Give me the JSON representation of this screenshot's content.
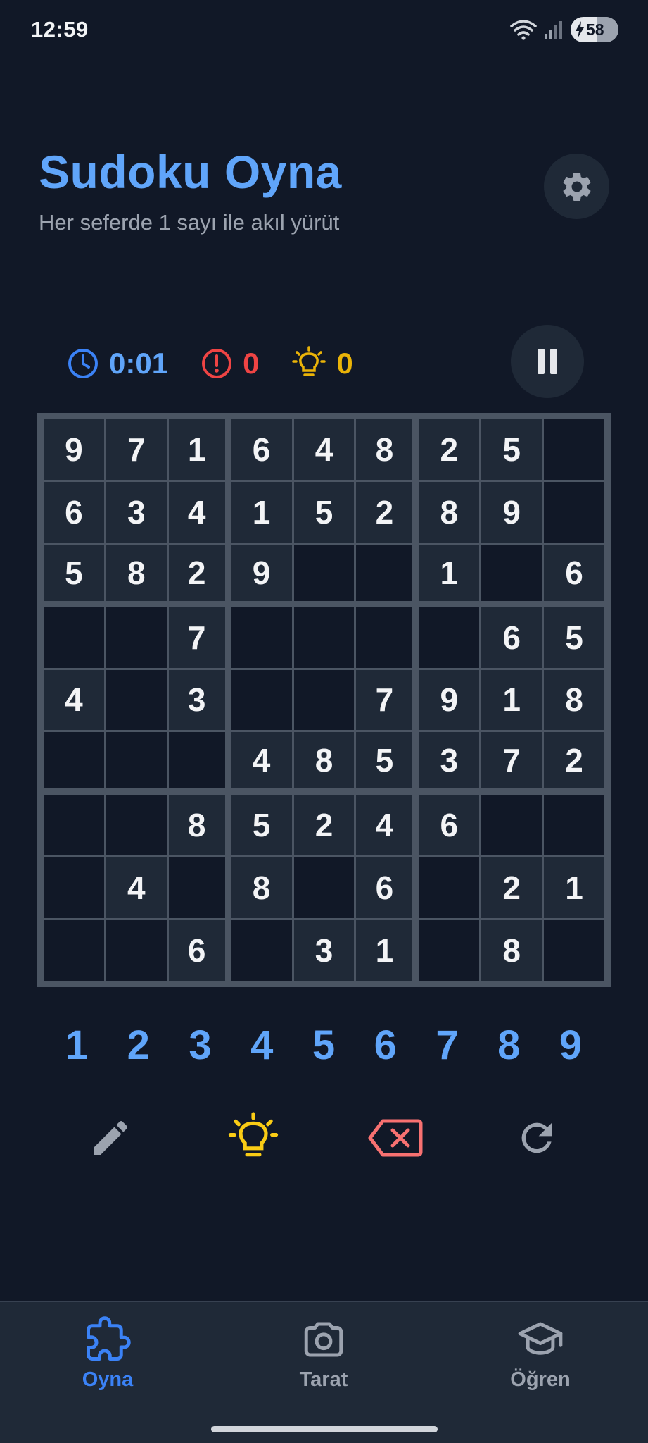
{
  "status": {
    "time": "12:59",
    "battery": "58"
  },
  "header": {
    "title": "Sudoku Oyna",
    "subtitle": "Her seferde 1 sayı ile akıl yürüt"
  },
  "stats": {
    "time": "0:01",
    "mistakes": "0",
    "hints": "0"
  },
  "board": [
    [
      "9",
      "7",
      "1",
      "6",
      "4",
      "8",
      "2",
      "5",
      ""
    ],
    [
      "6",
      "3",
      "4",
      "1",
      "5",
      "2",
      "8",
      "9",
      ""
    ],
    [
      "5",
      "8",
      "2",
      "9",
      "",
      "",
      "1",
      "",
      "6"
    ],
    [
      "",
      "",
      "7",
      "",
      "",
      "",
      "",
      "6",
      "5"
    ],
    [
      "4",
      "",
      "3",
      "",
      "",
      "7",
      "9",
      "1",
      "8"
    ],
    [
      "",
      "",
      "",
      "4",
      "8",
      "5",
      "3",
      "7",
      "2"
    ],
    [
      "",
      "",
      "8",
      "5",
      "2",
      "4",
      "6",
      "",
      ""
    ],
    [
      "",
      "4",
      "",
      "8",
      "",
      "6",
      "",
      "2",
      "1"
    ],
    [
      "",
      "",
      "6",
      "",
      "3",
      "1",
      "",
      "8",
      ""
    ]
  ],
  "numpad": [
    "1",
    "2",
    "3",
    "4",
    "5",
    "6",
    "7",
    "8",
    "9"
  ],
  "nav": [
    {
      "label": "Oyna",
      "icon": "puzzle-icon",
      "active": true
    },
    {
      "label": "Tarat",
      "icon": "camera-icon",
      "active": false
    },
    {
      "label": "Öğren",
      "icon": "graduation-cap-icon",
      "active": false
    }
  ],
  "colors": {
    "background": "#111827",
    "accent": "#60a5fa",
    "error": "#ef4444",
    "hint": "#eab308"
  }
}
